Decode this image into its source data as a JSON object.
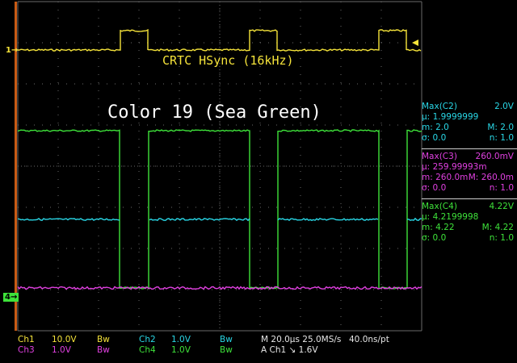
{
  "annotations": {
    "trace_title": "CRTC HSync (16kHz)",
    "color_title": "Color 19 (Sea Green)"
  },
  "markers": {
    "ch1": "1",
    "ch4": "4"
  },
  "measurements": [
    {
      "header": "Max(C2)",
      "value": "2.0V",
      "mean_label": "µ:",
      "mean": "1.9999999",
      "min_label": "m:",
      "min": "2.0",
      "max_label": "M:",
      "max": "2.0",
      "sigma_label": "σ:",
      "sigma": "0.0",
      "n_label": "n:",
      "n": "1.0",
      "color": "#29d7e6"
    },
    {
      "header": "Max(C3)",
      "value": "260.0mV",
      "mean_label": "µ:",
      "mean": "259.99993m",
      "min_label": "m:",
      "min": "260.0m",
      "max_label": "M:",
      "max": "260.0m",
      "sigma_label": "σ:",
      "sigma": "0.0",
      "n_label": "n:",
      "n": "1.0",
      "color": "#e040e0"
    },
    {
      "header": "Max(C4)",
      "value": "4.22V",
      "mean_label": "µ:",
      "mean": "4.2199998",
      "min_label": "m:",
      "min": "4.22",
      "max_label": "M:",
      "max": "4.22",
      "sigma_label": "σ:",
      "sigma": "0.0",
      "n_label": "n:",
      "n": "1.0",
      "color": "#3ee23a"
    }
  ],
  "status": {
    "ch1_label": "Ch1",
    "ch1_scale": "10.0V",
    "ch3_label": "Ch3",
    "ch3_scale": "1.0V",
    "ch2_label": "Ch2",
    "ch2_scale": "1.0V",
    "ch4_label": "Ch4",
    "ch4_scale": "1.0V",
    "bw1": "Bw",
    "bw2": "Bw",
    "bw3": "Bw",
    "bw4": "Bw",
    "timebase": "M 20.0µs 25.0MS/s",
    "sample_interval": "40.0ns/pt",
    "trigger": "A  Ch1  ↘  1.6V"
  },
  "colors": {
    "ch1": "#f5e33a",
    "ch2": "#29d7e6",
    "ch3": "#e040e0",
    "ch4": "#3ee23a",
    "grid": "#6a6a6a"
  }
}
